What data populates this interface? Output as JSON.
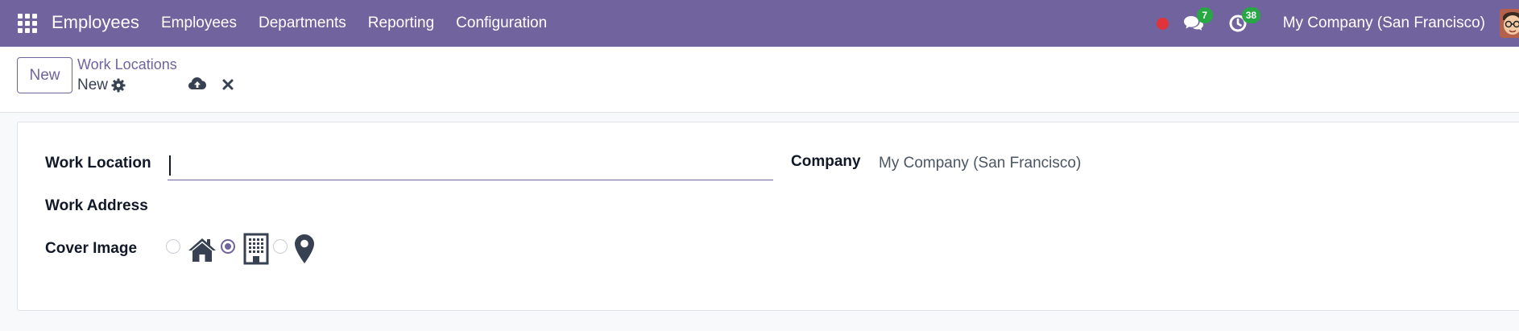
{
  "navbar": {
    "app_name": "Employees",
    "menu": [
      "Employees",
      "Departments",
      "Reporting",
      "Configuration"
    ],
    "messages_count": "7",
    "activities_count": "38",
    "company": "My Company (San Francisco)",
    "color": "#71639e"
  },
  "control_panel": {
    "new_label": "New",
    "breadcrumb": "Work Locations",
    "record_name": "New"
  },
  "form": {
    "work_location_label": "Work Location",
    "work_location_value": "",
    "work_address_label": "Work Address",
    "cover_image_label": "Cover Image",
    "cover_options": [
      {
        "icon": "home-icon",
        "selected": false
      },
      {
        "icon": "building-icon",
        "selected": true
      },
      {
        "icon": "map-marker-icon",
        "selected": false
      }
    ],
    "company_label": "Company",
    "company_value": "My Company (San Francisco)"
  }
}
